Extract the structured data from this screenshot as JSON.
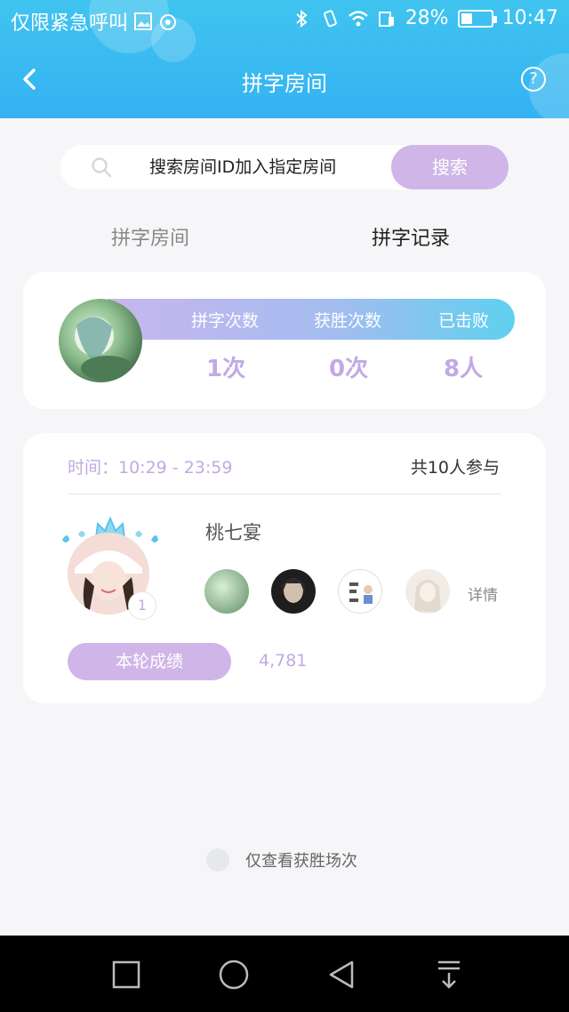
{
  "statusbar": {
    "left_text": "仅限紧急呼叫",
    "battery": "28%",
    "time": "10:47",
    "icons": [
      "image-icon",
      "sync-icon",
      "bluetooth-icon",
      "vibrate-icon",
      "wifi-icon",
      "sim-icon",
      "battery-icon"
    ]
  },
  "nav": {
    "title": "拼字房间",
    "back_icon": "back-arrow-icon",
    "help_label": "?"
  },
  "search": {
    "placeholder": "搜索房间ID加入指定房间",
    "button": "搜索",
    "icon": "search-icon"
  },
  "tabs": [
    {
      "label": "拼字房间",
      "active": false
    },
    {
      "label": "拼字记录",
      "active": true
    }
  ],
  "stats": {
    "items": [
      {
        "label": "拼字次数",
        "value": "1次"
      },
      {
        "label": "获胜次数",
        "value": "0次"
      },
      {
        "label": "已击败",
        "value": "8人"
      }
    ]
  },
  "record": {
    "time": "时间：10:29 - 23:59",
    "participants": "共10人参与",
    "winner_name": "桃七宴",
    "rank": "1",
    "details": "详情",
    "score_label": "本轮成绩",
    "score_value": "4,781"
  },
  "filter": {
    "label": "仅查看获胜场次",
    "checked": false
  },
  "colors": {
    "header": "#3fc4ef",
    "accent_purple": "#d0b6e8",
    "value_purple": "#c2a9e4"
  }
}
